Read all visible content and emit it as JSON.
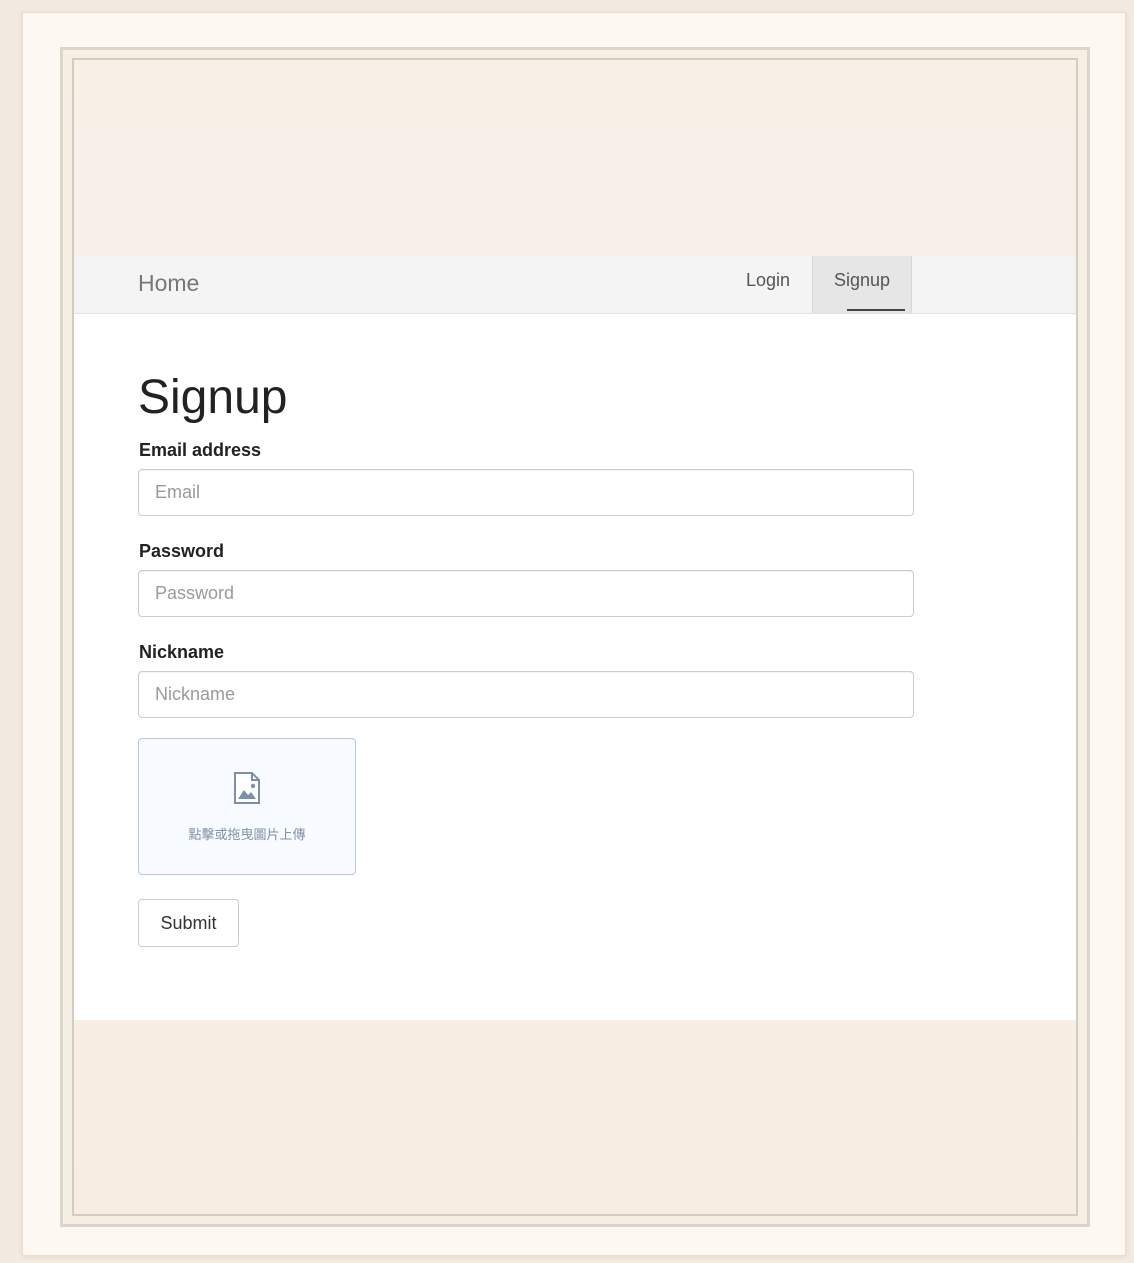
{
  "navbar": {
    "brand": "Home",
    "links": [
      {
        "label": "Login"
      },
      {
        "label": "Signup",
        "active": true
      }
    ]
  },
  "main": {
    "title": "Signup",
    "fields": [
      {
        "label": "Email address",
        "placeholder": "Email",
        "value": ""
      },
      {
        "label": "Password",
        "placeholder": "Password",
        "value": ""
      },
      {
        "label": "Nickname",
        "placeholder": "Nickname",
        "value": ""
      }
    ],
    "upload": {
      "icon": "image-icon",
      "text": "點擊或拖曳圖片上傳"
    },
    "submit_label": "Submit"
  },
  "colors": {
    "page_background": "#f3ebe1",
    "navbar_background": "#f4f4f4",
    "active_tab_background": "#e6e6e6",
    "upload_border": "#b9c6dd"
  }
}
